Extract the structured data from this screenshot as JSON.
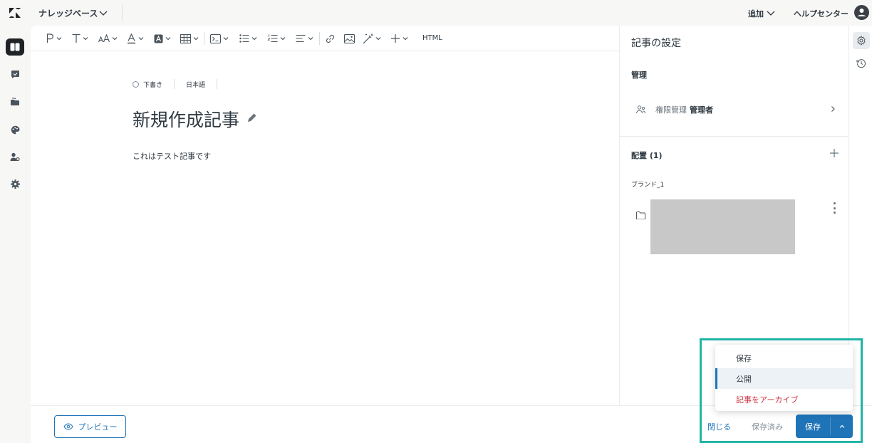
{
  "topbar": {
    "product_name": "ナレッジベース",
    "add_label": "追加",
    "help_center_label": "ヘルプセンター"
  },
  "toolbar": {
    "html_label": "HTML"
  },
  "editor": {
    "status": "下書き",
    "language": "日本語",
    "title": "新規作成記事",
    "body": "これはテスト記事です"
  },
  "settings_panel": {
    "title": "記事の設定",
    "management_heading": "管理",
    "permission_label": "権限管理",
    "permission_value": "管理者",
    "placement_heading": "配置 (1)",
    "brand_label": "ブランド_1"
  },
  "footer": {
    "preview_label": "プレビュー",
    "close_label": "閉じる",
    "saved_label": "保存済み",
    "save_label": "保存"
  },
  "dropdown": {
    "items": [
      {
        "label": "保存",
        "state": "normal"
      },
      {
        "label": "公開",
        "state": "selected"
      },
      {
        "label": "記事をアーカイブ",
        "state": "danger"
      }
    ]
  },
  "colors": {
    "accent": "#1f73b7",
    "danger": "#cc3340",
    "highlight": "#1fb4a5"
  },
  "icons": [
    "zendesk-logo-icon",
    "knowledge-icon",
    "moderation-icon",
    "folder-stack-icon",
    "palette-icon",
    "user-permissions-icon",
    "settings-icon",
    "gear-icon",
    "history-icon",
    "eye-icon",
    "folder-icon"
  ]
}
